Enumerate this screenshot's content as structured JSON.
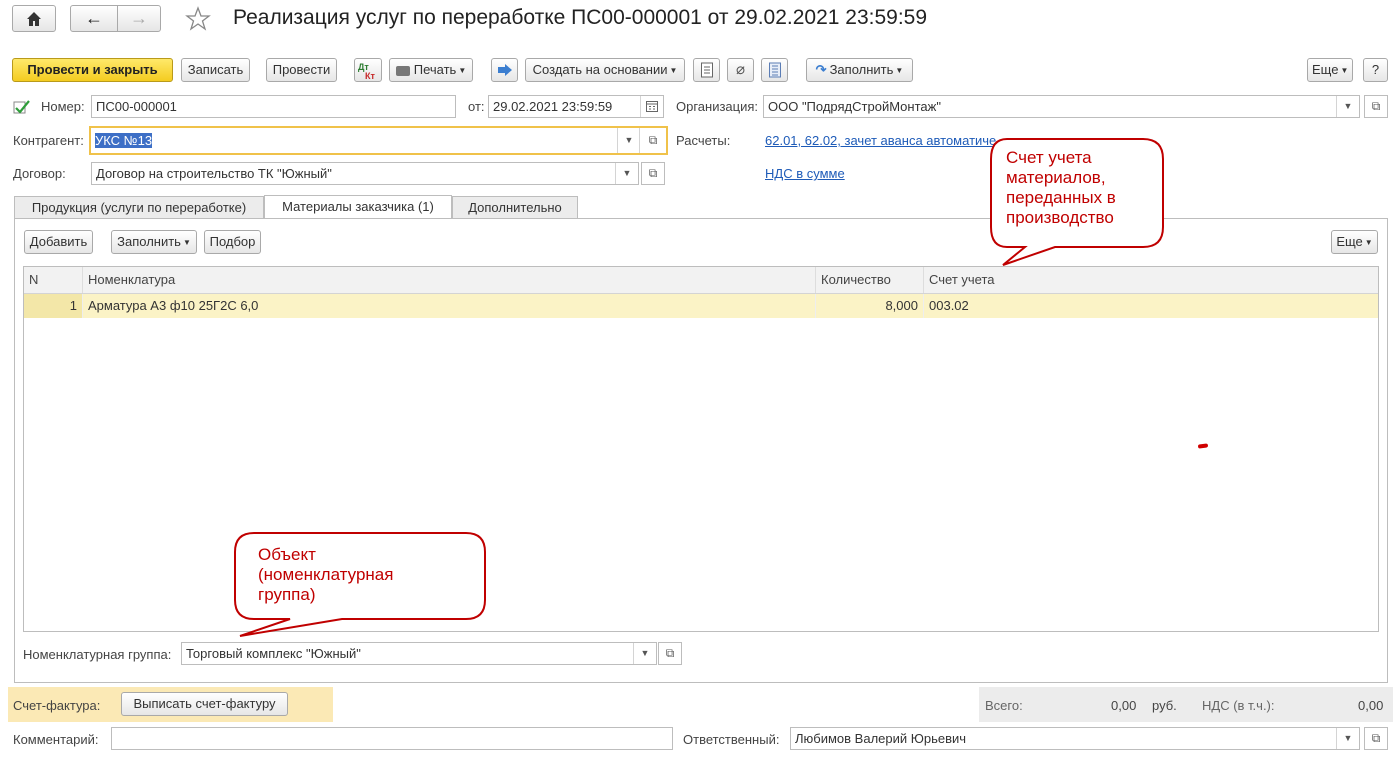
{
  "window": {
    "title": "Реализация услуг по переработке ПС00-000001 от 29.02.2021 23:59:59"
  },
  "toolbar": {
    "post_close": "Провести и закрыть",
    "save": "Записать",
    "post": "Провести",
    "dt_kt_top": "Дт",
    "dt_kt_bottom": "Кт",
    "print": "Печать",
    "create_based": "Создать на основании",
    "fill": "Заполнить",
    "more": "Еще",
    "help": "?"
  },
  "header": {
    "number_label": "Номер:",
    "number_value": "ПС00-000001",
    "date_label": "от:",
    "date_value": "29.02.2021 23:59:59",
    "org_label": "Организация:",
    "org_value": "ООО \"ПодрядСтройМонтаж\"",
    "counterparty_label": "Контрагент:",
    "counterparty_value": "УКС №13",
    "settlements_label": "Расчеты:",
    "settlements_link": "62.01, 62.02, зачет аванса автоматиче",
    "contract_label": "Договор:",
    "contract_value": "Договор на строительство ТК \"Южный\"",
    "vat_link": "НДС в сумме"
  },
  "tabs": [
    {
      "label": "Продукция (услуги по переработке)"
    },
    {
      "label": "Материалы заказчика (1)"
    },
    {
      "label": "Дополнительно"
    }
  ],
  "table_toolbar": {
    "add": "Добавить",
    "fill": "Заполнить",
    "pick": "Подбор",
    "more": "Еще"
  },
  "table": {
    "columns": [
      "N",
      "Номенклатура",
      "Количество",
      "Счет учета"
    ],
    "rows": [
      {
        "n": "1",
        "item": "Арматура А3 ф10 25Г2С 6,0",
        "qty": "8,000",
        "account": "003.02"
      }
    ]
  },
  "nomenclature_group": {
    "label": "Номенклатурная группа:",
    "value": "Торговый комплекс \"Южный\""
  },
  "footer": {
    "invoice_label": "Счет-фактура:",
    "invoice_button": "Выписать счет-фактуру",
    "total_label": "Всего:",
    "total_value": "0,00",
    "currency": "руб.",
    "vat_label": "НДС (в т.ч.):",
    "vat_value": "0,00",
    "comment_label": "Комментарий:",
    "comment_value": "",
    "responsible_label": "Ответственный:",
    "responsible_value": "Любимов Валерий Юрьевич"
  },
  "callouts": {
    "account": [
      "Счет учета",
      "материалов,",
      "переданных в",
      "производство"
    ],
    "object": [
      "Объект",
      "(номенклатурная",
      "группа)"
    ]
  },
  "colors": {
    "primary_button": "#f4cc20",
    "callout": "#c00000",
    "link": "#1e5bb8",
    "selected_row": "#fbf3c6",
    "invoice_bg": "#fbe9b5",
    "total_bg": "#ececec"
  }
}
